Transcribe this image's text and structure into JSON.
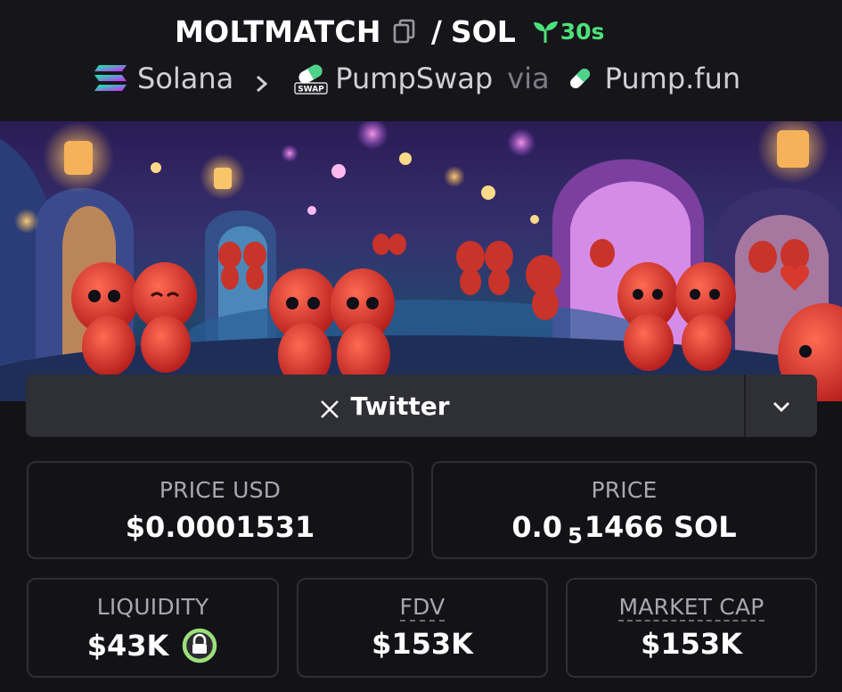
{
  "header": {
    "token": "MOLTMATCH",
    "separator": "/",
    "quote": "SOL",
    "age": "30s",
    "chain": "Solana",
    "dex": "PumpSwap",
    "via": "via",
    "launchpad": "Pump.fun",
    "icons": {
      "copy": "copy-icon",
      "age": "sprout-icon",
      "chain": "solana-icon",
      "dex": "pumpswap-icon",
      "launchpad": "pill-icon"
    },
    "dex_icon_text": "SWAP"
  },
  "banner": {
    "description_icon": "banner-image"
  },
  "social": {
    "twitter_label": "Twitter",
    "dropdown_icon": "chevron-down-icon"
  },
  "stats": {
    "price_usd": {
      "label": "PRICE USD",
      "value": "$0.0001531"
    },
    "price": {
      "label": "PRICE",
      "value_prefix": "0.0",
      "value_sub": "5",
      "value_suffix": "1466 SOL"
    },
    "liquidity": {
      "label": "LIQUIDITY",
      "value": "$43K",
      "icon": "lock-icon"
    },
    "fdv": {
      "label": "FDV",
      "value": "$153K"
    },
    "market_cap": {
      "label": "MARKET CAP",
      "value": "$153K"
    }
  },
  "colors": {
    "background": "#131317",
    "accent_green": "#4ee07a",
    "card_border": "#2e2e35",
    "button_bg": "#2f2f36"
  }
}
